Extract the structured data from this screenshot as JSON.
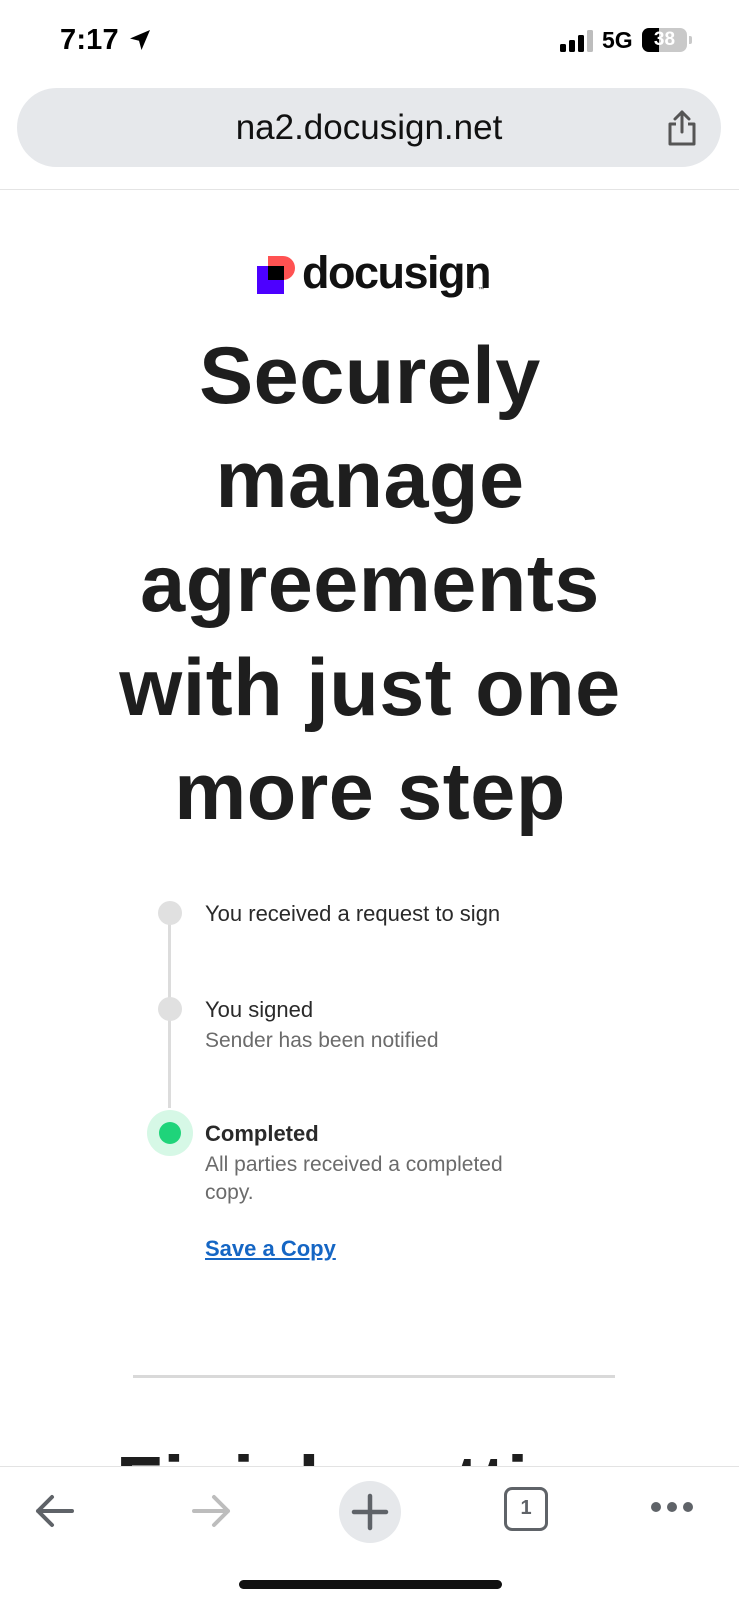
{
  "status_bar": {
    "time": "7:17",
    "network": "5G",
    "battery": "38",
    "battery_level": 0.38,
    "icons": [
      "location-arrow-icon",
      "signal-bars-icon",
      "battery-icon"
    ]
  },
  "browser": {
    "url": "na2.docusign.net",
    "share_icon": "share-icon",
    "toolbar": {
      "tab_count": "1",
      "icons": [
        "back-arrow-icon",
        "forward-arrow-icon",
        "plus-icon",
        "tabs-icon",
        "more-icon"
      ]
    }
  },
  "page": {
    "logo": {
      "wordmark": "docusign",
      "tm": "™",
      "colors": {
        "purple": "#4c00ff",
        "coral": "#ff5252",
        "black": "#000000"
      }
    },
    "headline": "Securely manage agreements with just one more step",
    "timeline": [
      {
        "title": "You received a request to sign",
        "subtitle": ""
      },
      {
        "title": "You signed",
        "subtitle": "Sender has been notified"
      },
      {
        "title": "Completed",
        "subtitle": "All parties received a completed copy.",
        "active": true
      }
    ],
    "save_link": "Save a Copy",
    "next_heading": "Finish setting"
  },
  "colors": {
    "active_dot": "#1fd47a",
    "link": "#1566c4",
    "url_bar": "#e6e8eb"
  }
}
